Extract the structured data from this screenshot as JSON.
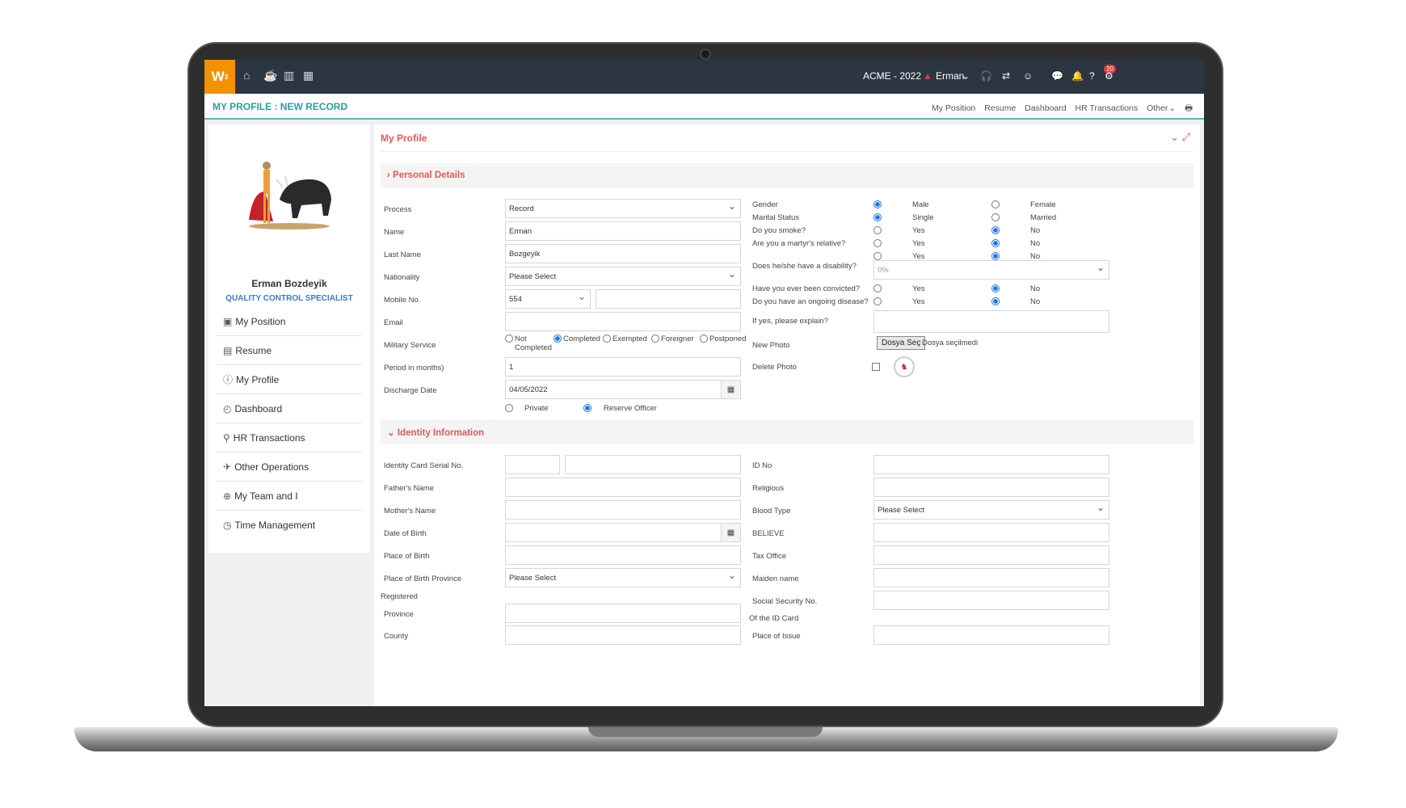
{
  "topbar": {
    "logo": "W",
    "company": "ACME - 2022",
    "user": "Erman",
    "notif_count": "20"
  },
  "title_bar": {
    "title": "MY PROFILE : NEW RECORD",
    "links": [
      "My Position",
      "Resume",
      "Dashboard",
      "HR Transactions",
      "Other"
    ]
  },
  "profile": {
    "name": "Erman Bozdeyik",
    "role": "QUALITY CONTROL SPECIALIST"
  },
  "menu": [
    "My Position",
    "Resume",
    "My Profile",
    "Dashboard",
    "HR Transactions",
    "Other Operations",
    "My Team and I",
    "Time Management"
  ],
  "main": {
    "title": "My Profile"
  },
  "personal": {
    "header": "Personal Details",
    "process": {
      "label": "Process",
      "value": "Record"
    },
    "name": {
      "label": "Name",
      "value": "Erman"
    },
    "last_name": {
      "label": "Last Name",
      "value": "Bozgeyik"
    },
    "nationality": {
      "label": "Nationality",
      "value": "Please Select"
    },
    "mobile": {
      "label": "Mobile No.",
      "code": "554"
    },
    "email": {
      "label": "Email"
    },
    "military": {
      "label": "Military Service",
      "options": [
        "Not",
        "Completed",
        "Completed",
        "Exempted",
        "Foreigner",
        "Postponed"
      ]
    },
    "period": {
      "label": "Period in months)",
      "value": "1"
    },
    "discharge": {
      "label": "Discharge Date",
      "value": "04/05/2022"
    },
    "rank": {
      "private": "Private",
      "reserve": "Reserve Officer"
    },
    "gender": {
      "label": "Gender",
      "male": "Male",
      "female": "Female"
    },
    "marital": {
      "label": "Marital Status",
      "single": "Single",
      "married": "Married"
    },
    "smoke": {
      "label": "Do you smoke?"
    },
    "martyr": {
      "label": "Are you a martyr's relative?"
    },
    "yes": "Yes",
    "no": "No",
    "disability": {
      "label": "Does he/she have a disability?",
      "value": "0%"
    },
    "convicted": {
      "label": "Have you ever been convicted?"
    },
    "disease": {
      "label": "Do you have an ongoing disease?"
    },
    "explain": {
      "label": "If yes, please explain?"
    },
    "new_photo": {
      "label": "New Photo",
      "button": "Dosya Seç",
      "status": "Dosya seçilmedi"
    },
    "delete_photo": {
      "label": "Delete Photo"
    }
  },
  "identity": {
    "header": "Identity Information",
    "left": [
      "Identity Card Serial No.",
      "Father's Name",
      "Mother's Name",
      "Date of Birth",
      "Place of Birth",
      "Place of Birth Province",
      "Registered",
      "Province",
      "County"
    ],
    "right": [
      "ID No",
      "Religious",
      "Blood Type",
      "BELIEVE",
      "Tax Office",
      "Maiden name",
      "Social Security No.",
      "Of the ID Card",
      "Place of Issue"
    ],
    "please_select": "Please Select"
  }
}
